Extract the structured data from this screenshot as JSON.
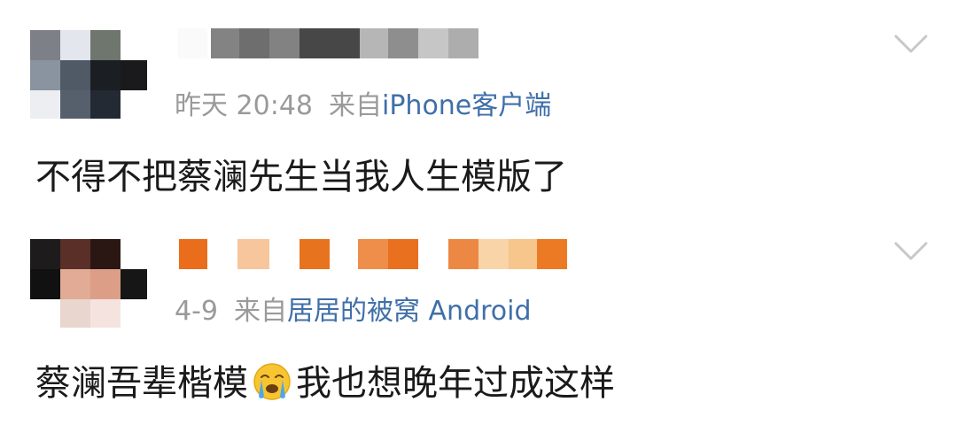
{
  "comments": [
    {
      "time": "昨天 20:48",
      "from_label": "来自",
      "source": "iPhone客户端",
      "text": "不得不把蔡澜先生当我人生模版了",
      "avatar_icon": "pixelated-avatar-icon",
      "more_icon": "chevron-down-icon"
    },
    {
      "time": "4-9",
      "from_label": "来自",
      "source": "居居的被窝 Android",
      "text_before_emoji": "蔡澜吾辈楷模",
      "emoji": "crying-face-emoji-icon",
      "text_after_emoji": "我也想晚年过成这样",
      "avatar_icon": "pixelated-avatar-icon",
      "more_icon": "chevron-down-icon"
    }
  ],
  "colors": {
    "meta_gray": "#9a9a9a",
    "source_blue": "#3f6fa8",
    "body_text": "#1a1a1a",
    "chevron_gray": "#c8c8c8"
  }
}
